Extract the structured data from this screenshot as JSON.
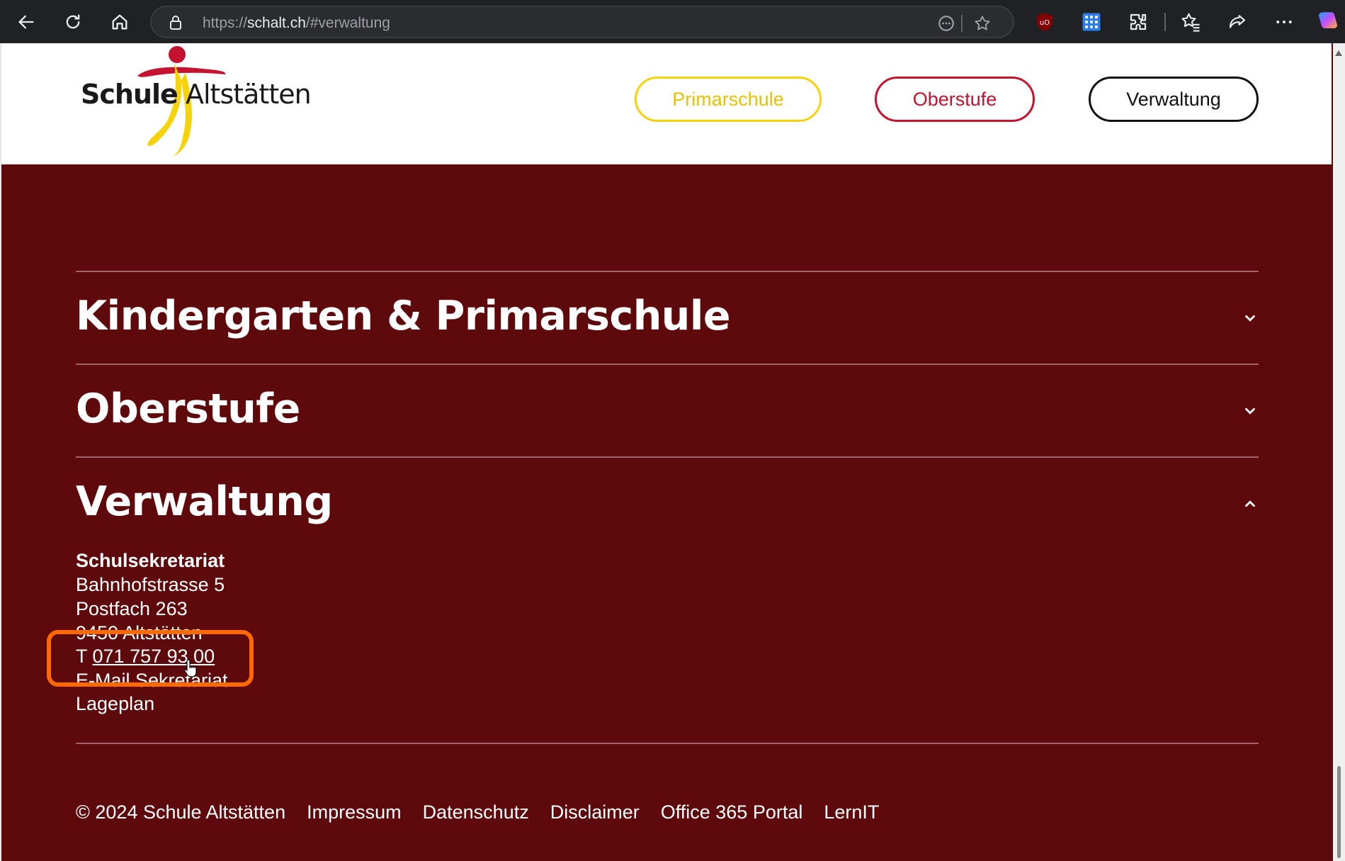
{
  "browser": {
    "url_prefix": "https://",
    "url_host": "schalt.ch",
    "url_path": "/#verwaltung",
    "extensions": [
      "ublock-icon",
      "grid-app-icon",
      "extensions-icon",
      "favorites-icon",
      "share-icon",
      "more-icon",
      "copilot-icon"
    ]
  },
  "header": {
    "logo_word1": "Schule",
    "logo_word2": "Altstätten",
    "nav": [
      {
        "label": "Primarschule",
        "color": "#f5d20a"
      },
      {
        "label": "Oberstufe",
        "color": "#c4122f"
      },
      {
        "label": "Verwaltung",
        "color": "#111111"
      }
    ]
  },
  "accordion": [
    {
      "title": "Kindergarten & Primarschule",
      "expanded": false
    },
    {
      "title": "Oberstufe",
      "expanded": false
    },
    {
      "title": "Verwaltung",
      "expanded": true
    }
  ],
  "verwaltung": {
    "heading": "Schulsekretariat",
    "street": "Bahnhofstrasse 5",
    "postbox": "Postfach 263",
    "city": "9450 Altstätten",
    "phone_prefix": "T ",
    "phone": "071 757 93 00",
    "email_link": "E-Mail Sekretariat",
    "map_link": "Lageplan"
  },
  "footer": {
    "copyright": "© 2024 Schule Altstätten",
    "links": [
      "Impressum",
      "Datenschutz",
      "Disclaimer",
      "Office 365 Portal",
      "LernIT"
    ]
  },
  "colors": {
    "page_bg": "#5e0a0d",
    "highlight": "#ff6a00"
  }
}
